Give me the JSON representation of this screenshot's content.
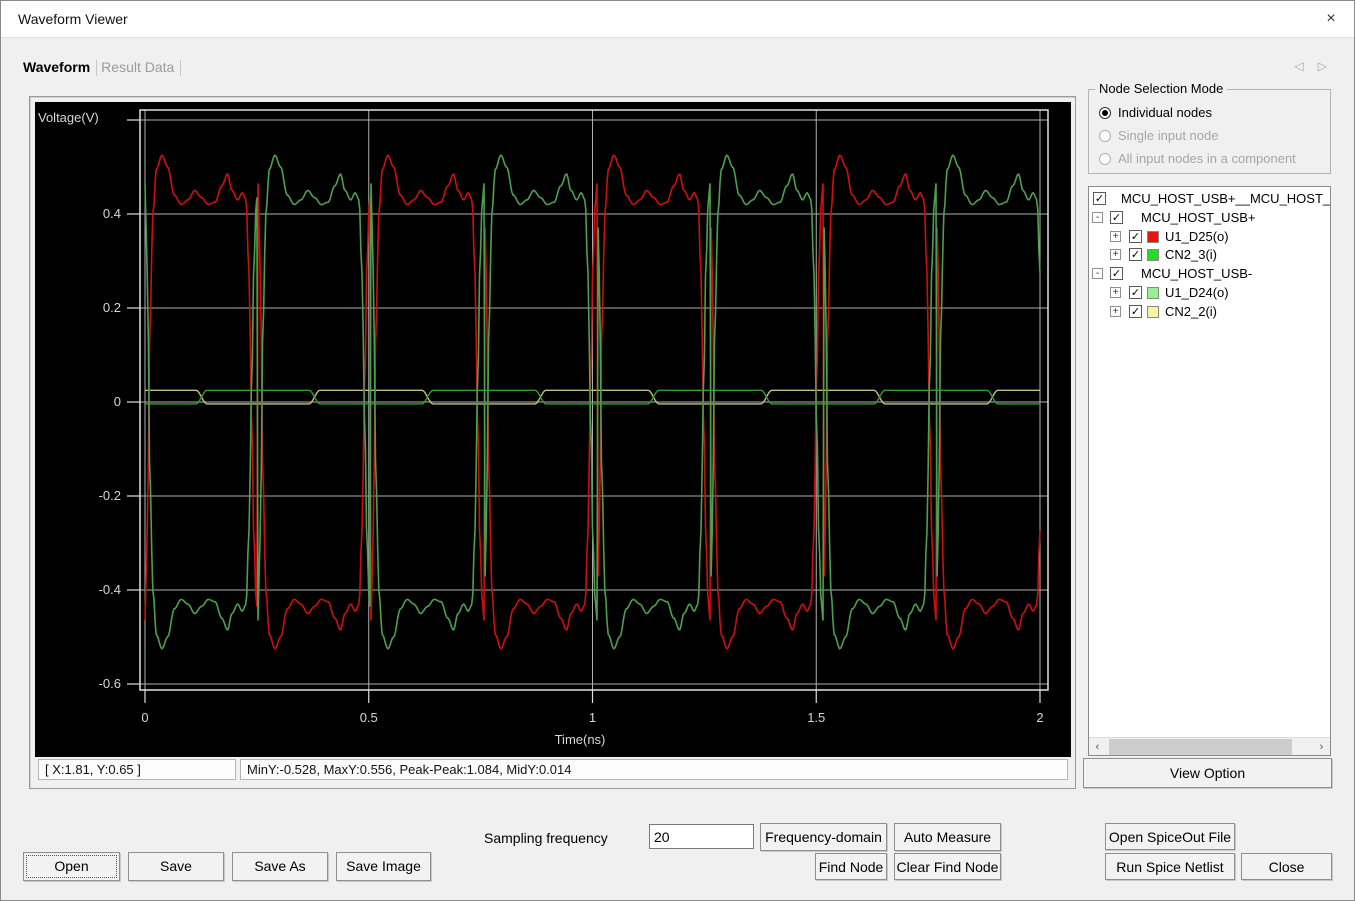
{
  "window": {
    "title": "Waveform Viewer",
    "close_glyph": "×"
  },
  "tabs": {
    "items": [
      {
        "label": "Waveform",
        "active": true
      },
      {
        "label": "Result Data",
        "active": false
      }
    ],
    "scroll_left_glyph": "◁",
    "scroll_right_glyph": "▷"
  },
  "status": {
    "cursor": "[ X:1.81, Y:0.65 ]",
    "measure": "MinY:-0.528, MaxY:0.556, Peak-Peak:1.084, MidY:0.014"
  },
  "node_selection": {
    "title": "Node Selection Mode",
    "options": [
      {
        "label": "Individual nodes",
        "selected": true,
        "enabled": true
      },
      {
        "label": "Single input node",
        "selected": false,
        "enabled": false
      },
      {
        "label": "All input nodes in a component",
        "selected": false,
        "enabled": false
      }
    ]
  },
  "tree": {
    "items": [
      {
        "label": "MCU_HOST_USB+__MCU_HOST_",
        "level": 0,
        "checked": true,
        "expander": null,
        "swatch": null
      },
      {
        "label": "MCU_HOST_USB+",
        "level": 1,
        "checked": true,
        "expander": "-",
        "swatch": null
      },
      {
        "label": "U1_D25(o)",
        "level": 2,
        "checked": true,
        "expander": "+",
        "swatch": "#ee1111"
      },
      {
        "label": "CN2_3(i)",
        "level": 2,
        "checked": true,
        "expander": "+",
        "swatch": "#22dd22"
      },
      {
        "label": "MCU_HOST_USB-",
        "level": 1,
        "checked": true,
        "expander": "-",
        "swatch": null
      },
      {
        "label": "U1_D24(o)",
        "level": 2,
        "checked": true,
        "expander": "+",
        "swatch": "#99ee99"
      },
      {
        "label": "CN2_2(i)",
        "level": 2,
        "checked": true,
        "expander": "+",
        "swatch": "#f5f5a5"
      }
    ],
    "checkbox_glyph": "✓",
    "scrollbar": {
      "left_glyph": "‹",
      "right_glyph": "›"
    }
  },
  "toolbar": {
    "open": "Open",
    "save": "Save",
    "save_as": "Save As",
    "save_image": "Save Image",
    "frequency_domain": "Frequency-domain",
    "auto_measure": "Auto Measure",
    "find_node": "Find Node",
    "clear_find_node": "Clear Find Node",
    "view_option": "View Option",
    "open_spiceout": "Open SpiceOut File",
    "run_spice": "Run Spice Netlist",
    "close": "Close"
  },
  "sampling": {
    "label": "Sampling frequency",
    "value": "20"
  },
  "chart_data": {
    "type": "line",
    "title": "",
    "xlabel": "Time(ns)",
    "ylabel": "Voltage(V)",
    "xlim": [
      0,
      2
    ],
    "ylim": [
      -0.65,
      0.65
    ],
    "x_ticks": [
      0,
      0.5,
      1,
      1.5,
      2
    ],
    "x_tick_labels": [
      "0",
      "0.5",
      "1",
      "1.5",
      "2"
    ],
    "y_ticks": [
      0.6,
      0.4,
      0.2,
      0,
      -0.2,
      -0.4,
      -0.6
    ],
    "y_tick_labels": [
      "",
      "0.4",
      "0.2",
      "0",
      "-0.2",
      "-0.4",
      "-0.6"
    ],
    "grid": true,
    "legend_position": "none",
    "plot_bg": "#000000",
    "grid_color": "#b0b0b0",
    "frame_color": "#e0e0e0",
    "text_color": "#d6d6d6",
    "period_ns": 0.505,
    "sample_step_ns": 0.0025,
    "half_cycle_shape": [
      [
        0.0,
        -0.93
      ],
      [
        0.02,
        -0.55
      ],
      [
        0.045,
        0.35
      ],
      [
        0.07,
        0.8
      ],
      [
        0.1,
        0.99
      ],
      [
        0.15,
        1.05
      ],
      [
        0.2,
        1.0
      ],
      [
        0.26,
        0.88
      ],
      [
        0.32,
        0.84
      ],
      [
        0.38,
        0.86
      ],
      [
        0.44,
        0.9
      ],
      [
        0.5,
        0.87
      ],
      [
        0.56,
        0.84
      ],
      [
        0.62,
        0.85
      ],
      [
        0.68,
        0.92
      ],
      [
        0.73,
        0.97
      ],
      [
        0.77,
        0.9
      ],
      [
        0.82,
        0.86
      ],
      [
        0.86,
        0.89
      ],
      [
        0.895,
        0.86
      ],
      [
        0.92,
        0.55
      ],
      [
        0.945,
        -0.1
      ],
      [
        0.965,
        -0.6
      ],
      [
        0.985,
        -0.85
      ],
      [
        1.0,
        -0.93
      ]
    ],
    "nearzero_transition_frac": 0.05,
    "series": [
      {
        "name": "CN2_2(i)",
        "color": "#c0c080",
        "kind": "nearzero",
        "invert": false,
        "high": 0.025,
        "low": -0.004
      },
      {
        "name": "U1_D24(o)",
        "color": "#2f9e2f",
        "kind": "nearzero",
        "invert": true,
        "high": 0.025,
        "low": -0.004
      },
      {
        "name": "U1_D25(o)",
        "color": "#cf0f0f",
        "kind": "differential",
        "invert": false,
        "amplitude": 0.5
      },
      {
        "name": "CN2_3(i)",
        "color": "#4da04d",
        "kind": "differential",
        "invert": true,
        "amplitude": 0.5
      }
    ]
  }
}
